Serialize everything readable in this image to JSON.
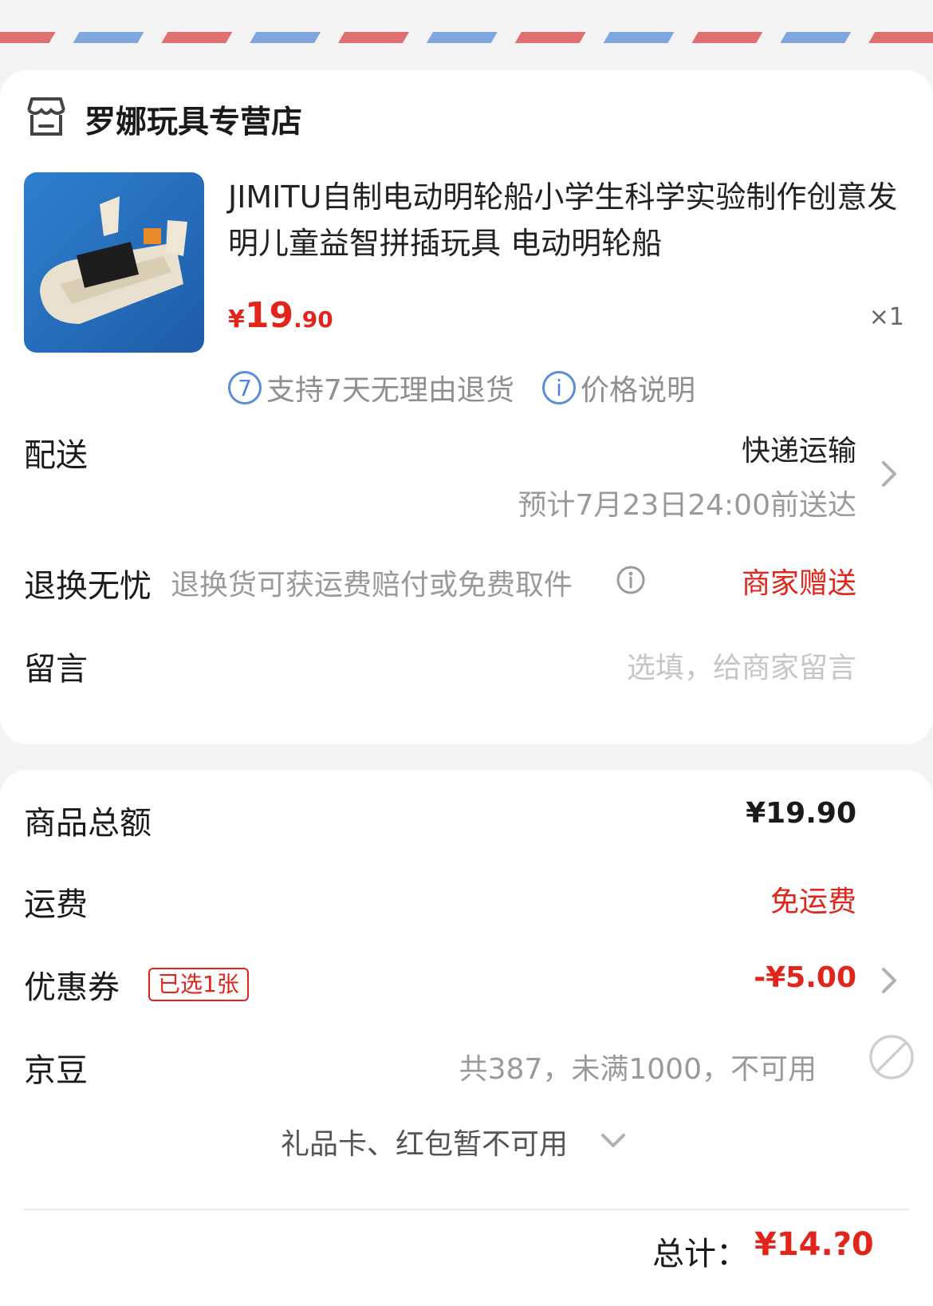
{
  "shop": {
    "name": "罗娜玩具专营店",
    "icon": "store-icon"
  },
  "product": {
    "title": "JIMITU自制电动明轮船小学生科学实验制作创意发明儿童益智拼插玩具 电动明轮船",
    "price_currency": "¥",
    "price_int": "19",
    "price_dec": ".90",
    "quantity": "×1",
    "tags": [
      {
        "icon": "7",
        "text": "支持7天无理由退货"
      },
      {
        "icon": "i",
        "text": "价格说明"
      }
    ]
  },
  "delivery": {
    "label": "配送",
    "method": "快递运输",
    "eta": "预计7月23日24:00前送达"
  },
  "returns": {
    "label": "退换无忧",
    "desc": "退换货可获运费赔付或免费取件",
    "value": "商家赠送"
  },
  "message": {
    "label": "留言",
    "placeholder": "选填，给商家留言"
  },
  "summary": {
    "goods_total_label": "商品总额",
    "goods_total": "¥19.90",
    "shipping_label": "运费",
    "shipping": "免运费",
    "coupon_label": "优惠券",
    "coupon_badge": "已选1张",
    "coupon_value": "-¥5.00",
    "jingdou_label": "京豆",
    "jingdou_value": "共387，未满1000，不可用",
    "giftcard_text": "礼品卡、红包暂不可用",
    "total_label": "总计：",
    "total_value": "¥14.?0"
  },
  "colors": {
    "accent": "#e1251b",
    "info": "#5a8fd8",
    "muted": "#9a9a9a"
  }
}
